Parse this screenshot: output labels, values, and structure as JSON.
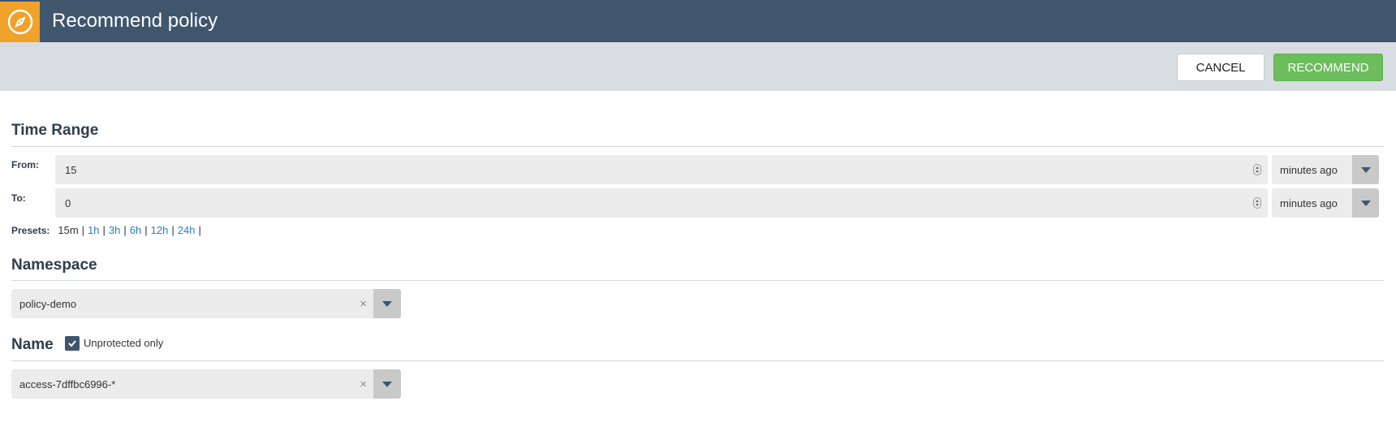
{
  "header": {
    "title": "Recommend policy",
    "logo_icon": "compass-icon",
    "accent_color": "#f0a22a",
    "bar_color": "#3f566d"
  },
  "toolbar": {
    "cancel_label": "CANCEL",
    "recommend_label": "RECOMMEND",
    "recommend_color": "#6cbd5c"
  },
  "time_range": {
    "title": "Time Range",
    "from_label": "From:",
    "from_value": "15",
    "from_unit": "minutes ago",
    "to_label": "To:",
    "to_value": "0",
    "to_unit": "minutes ago",
    "presets_label": "Presets:",
    "presets": [
      "15m",
      "1h",
      "3h",
      "6h",
      "12h",
      "24h"
    ]
  },
  "namespace": {
    "title": "Namespace",
    "value": "policy-demo"
  },
  "name": {
    "title": "Name",
    "checkbox_label": "Unprotected only",
    "checkbox_checked": true,
    "value": "access-7dffbc6996-*"
  }
}
